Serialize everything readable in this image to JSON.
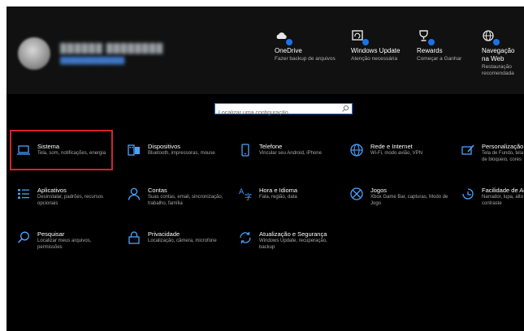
{
  "promos": [
    {
      "title": "OneDrive",
      "desc": "Fazer backup de arquivos",
      "icon": "cloud-icon"
    },
    {
      "title": "Windows Update",
      "desc": "Atenção necessária",
      "icon": "update-icon"
    },
    {
      "title": "Rewards",
      "desc": "Começar a Ganhar",
      "icon": "trophy-icon"
    },
    {
      "title": "Navegação na Web",
      "desc": "Restauração recomendada",
      "icon": "globe-icon"
    }
  ],
  "search": {
    "placeholder": "Localizar uma configuração"
  },
  "tiles": [
    {
      "title": "Sistema",
      "desc": "Tela, som, notificações, energia",
      "icon": "laptop-icon"
    },
    {
      "title": "Dispositivos",
      "desc": "Bluetooth, impressoras, mouse",
      "icon": "keyboard-icon"
    },
    {
      "title": "Telefone",
      "desc": "Vincular seu Android, iPhone",
      "icon": "phone-icon"
    },
    {
      "title": "Rede e Internet",
      "desc": "Wi-Fi, modo avião, VPN",
      "icon": "globe-icon"
    },
    {
      "title": "Personalização",
      "desc": "Tela de Fundo, tela de bloqueio, cores",
      "icon": "brush-icon"
    },
    {
      "title": "Aplicativos",
      "desc": "Desinstalar, padrões, recursos opcionais",
      "icon": "apps-list-icon"
    },
    {
      "title": "Contas",
      "desc": "Suas contas, email, sincronização, trabalho, família",
      "icon": "person-icon"
    },
    {
      "title": "Hora e Idioma",
      "desc": "Fala, região, data",
      "icon": "language-icon"
    },
    {
      "title": "Jogos",
      "desc": "Xbox Game Bar, capturas, Modo de Jogo",
      "icon": "xbox-icon"
    },
    {
      "title": "Facilidade de Acesso",
      "desc": "Narrador, lupa, alto contraste",
      "icon": "accessibility-icon"
    },
    {
      "title": "Pesquisar",
      "desc": "Localizar meus arquivos, permissões",
      "icon": "search-icon"
    },
    {
      "title": "Privacidade",
      "desc": "Localização, câmera, microfone",
      "icon": "lock-icon"
    },
    {
      "title": "Atualização e Segurança",
      "desc": "Windows Update, recuperação, backup",
      "icon": "sync-icon"
    }
  ]
}
